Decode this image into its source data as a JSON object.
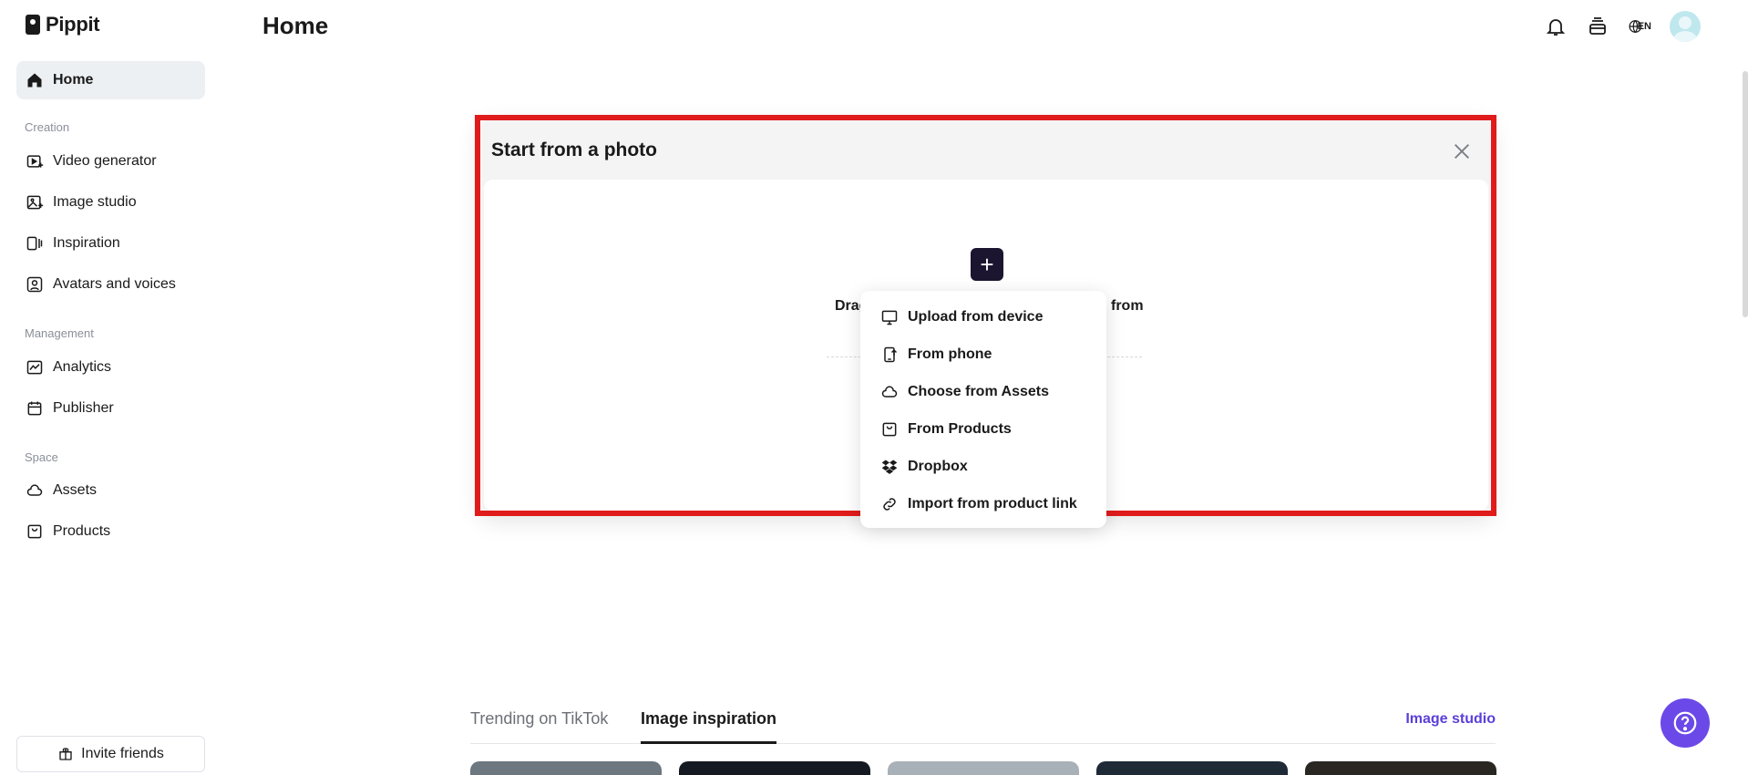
{
  "app": {
    "name": "Pippit"
  },
  "header": {
    "title": "Home",
    "language": "EN"
  },
  "sidebar": {
    "home": "Home",
    "sections": {
      "creation": "Creation",
      "management": "Management",
      "space": "Space"
    },
    "items": {
      "video_generator": "Video generator",
      "image_studio": "Image studio",
      "inspiration": "Inspiration",
      "avatars_voices": "Avatars and voices",
      "analytics": "Analytics",
      "publisher": "Publisher",
      "assets": "Assets",
      "products": "Products"
    },
    "invite": "Invite friends"
  },
  "panel": {
    "title": "Start from a photo",
    "plus": "+",
    "drag_left": "Drag",
    "drag_right": "from"
  },
  "dropdown": {
    "items": [
      {
        "label": "Upload from device",
        "icon": "monitor-icon"
      },
      {
        "label": "From phone",
        "icon": "phone-upload-icon"
      },
      {
        "label": "Choose from Assets",
        "icon": "cloud-icon"
      },
      {
        "label": "From Products",
        "icon": "bag-icon"
      },
      {
        "label": "Dropbox",
        "icon": "dropbox-icon"
      },
      {
        "label": "Import from product link",
        "icon": "link-icon"
      }
    ]
  },
  "tabs": {
    "trending": "Trending on TikTok",
    "image_inspiration": "Image inspiration",
    "link": "Image studio"
  },
  "colors": {
    "accent": "#5b3fd9",
    "fab": "#6b49e8",
    "highlight": "#e01b1b",
    "active_nav": "#ecf0f3"
  }
}
